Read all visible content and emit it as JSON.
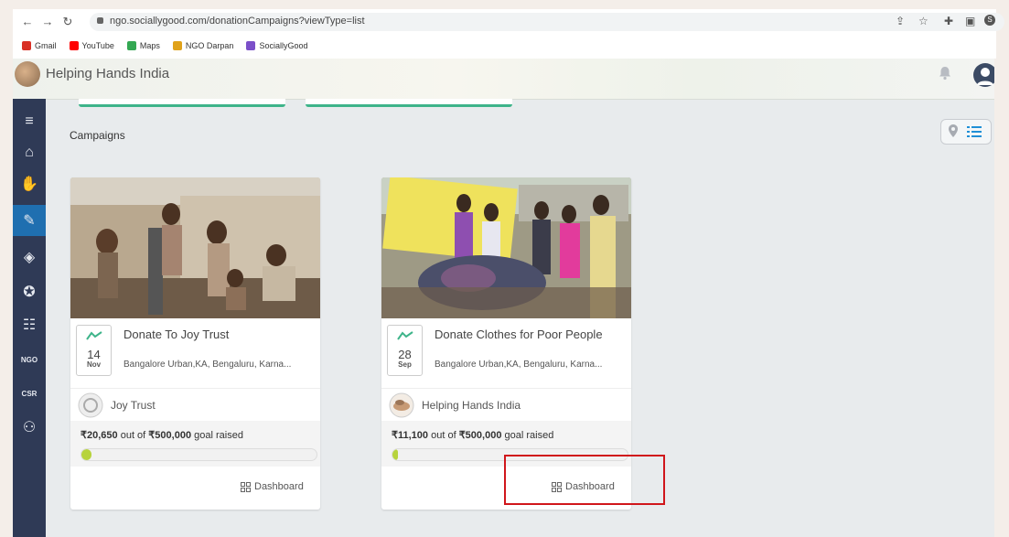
{
  "browser": {
    "url": "ngo.sociallygood.com/donationCampaigns?viewType=list",
    "bookmarks": [
      {
        "label": "Gmail",
        "icon": "gmail-icon",
        "color": "#d93025"
      },
      {
        "label": "YouTube",
        "icon": "youtube-icon",
        "color": "#ff0000"
      },
      {
        "label": "Maps",
        "icon": "maps-icon",
        "color": "#34a853"
      },
      {
        "label": "NGO Darpan",
        "icon": "ngo-darpan-icon",
        "color": "#e0a21a"
      },
      {
        "label": "SociallyGood",
        "icon": "sociallygood-icon",
        "color": "#7b4fc9"
      }
    ]
  },
  "app": {
    "title": "Helping Hands India"
  },
  "sidebar": {
    "items": [
      {
        "icon": "menu-icon",
        "glyph": "≡",
        "active": false
      },
      {
        "icon": "home-icon",
        "glyph": "⌂",
        "active": false
      },
      {
        "icon": "hands-icon",
        "glyph": "✋",
        "active": false
      },
      {
        "icon": "donation-campaigns-icon",
        "glyph": "✎",
        "active": true
      },
      {
        "icon": "badge-icon",
        "glyph": "◈",
        "active": false
      },
      {
        "icon": "award-icon",
        "glyph": "✪",
        "active": false
      },
      {
        "icon": "contacts-icon",
        "glyph": "☷",
        "active": false
      },
      {
        "icon": "ngo-icon",
        "glyph": "NGO",
        "active": false
      },
      {
        "icon": "csr-icon",
        "glyph": "CSR",
        "active": false
      },
      {
        "icon": "users-icon",
        "glyph": "⚇",
        "active": false
      }
    ]
  },
  "main": {
    "section_title": "Campaigns",
    "cards": [
      {
        "title": "Donate To Joy Trust",
        "day": "14",
        "month": "Nov",
        "location": "Bangalore Urban,KA, Bengaluru, Karna...",
        "org_name": "Joy Trust",
        "raised": "₹20,650",
        "goal_prefix": " out of ",
        "goal": "₹500,000",
        "goal_suffix": " goal raised",
        "progress": 4.1,
        "dashboard_label": "Dashboard"
      },
      {
        "title": "Donate Clothes for Poor People",
        "day": "28",
        "month": "Sep",
        "location": "Bangalore Urban,KA, Bengaluru, Karna...",
        "org_name": "Helping Hands India",
        "raised": "₹11,100",
        "goal_prefix": " out of ",
        "goal": "₹500,000",
        "goal_suffix": " goal raised",
        "progress": 2.2,
        "dashboard_label": "Dashboard"
      }
    ]
  },
  "colors": {
    "sidebar_bg": "#2f3a56",
    "sidebar_active": "#1f6fb0",
    "accent_green": "#3eb48a",
    "progress_fill": "#b7d33d",
    "highlight_red": "#d0161b"
  }
}
